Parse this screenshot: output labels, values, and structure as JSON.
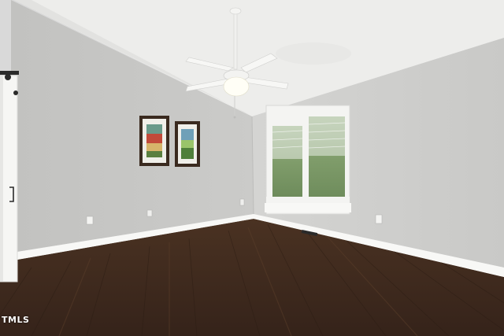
{
  "scene": {
    "description_tag": "empty-room-with-ceiling-fan",
    "colors": {
      "ceiling": "#eeeeee",
      "left_wall": "#c8c8c6",
      "right_wall": "#cfcfcd",
      "floor": "#3f2a1d",
      "baseboard": "#f7f7f5",
      "window_frame": "#f4f4f2",
      "door": "#f6f6f4"
    }
  },
  "watermark": {
    "text": "TMLS"
  }
}
